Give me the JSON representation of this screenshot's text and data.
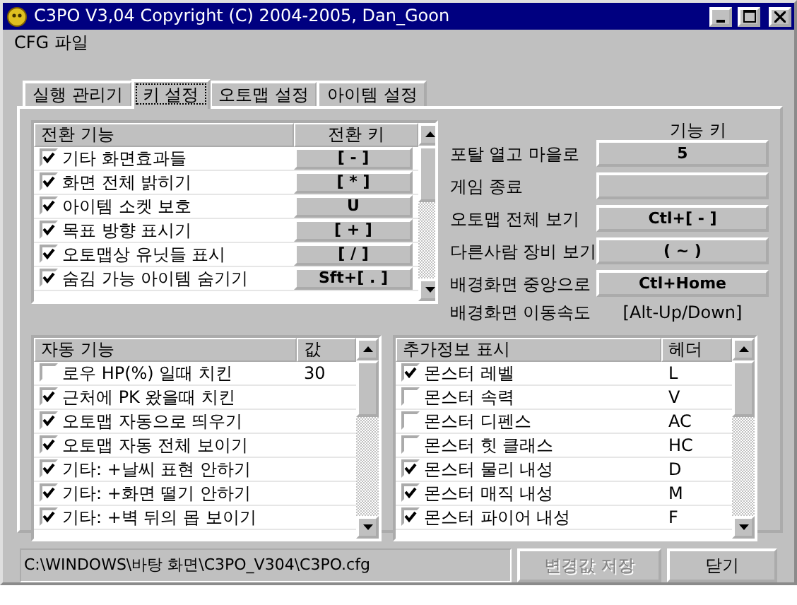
{
  "window": {
    "title": "C3PO V3,04 Copyright (C) 2004-2005, Dan_Goon"
  },
  "menu": [
    "CFG 파일"
  ],
  "tabs": [
    {
      "label": "실행 관리기",
      "selected": false
    },
    {
      "label": "키 설정",
      "selected": true
    },
    {
      "label": "오토맵 설정",
      "selected": false
    },
    {
      "label": "아이템 설정",
      "selected": false
    }
  ],
  "toggle_list": {
    "columns": [
      "전환 기능",
      "전환 키"
    ],
    "rows": [
      {
        "label": "기타 화면효과들",
        "checked": true,
        "key": "[ - ]"
      },
      {
        "label": "화면 전체 밝히기",
        "checked": true,
        "key": "[ * ]"
      },
      {
        "label": "아이템 소켓 보호",
        "checked": true,
        "key": "U"
      },
      {
        "label": "목표 방향 표시기",
        "checked": true,
        "key": "[ + ]"
      },
      {
        "label": "오토맵상 유닛들 표시",
        "checked": true,
        "key": "[ / ]"
      },
      {
        "label": "숨김 가능 아이템 숨기기",
        "checked": true,
        "key": "Sft+[ . ]"
      }
    ]
  },
  "function_keys": {
    "heading": "기능 키",
    "rows": [
      {
        "kind": "button",
        "label": "포탈 열고 마을로",
        "key": "5"
      },
      {
        "kind": "button",
        "label": "게임 종료"
      },
      {
        "kind": "button",
        "label": "오토맵 전체 보기",
        "key": "Ctl+[ - ]"
      },
      {
        "kind": "button",
        "label": "다른사람 장비 보기",
        "key": "( ~ )"
      },
      {
        "kind": "button",
        "label": "배경화면 중앙으로",
        "key": "Ctl+Home"
      },
      {
        "kind": "text",
        "label": "배경화면 이동속도",
        "key": "[Alt-Up/Down]"
      }
    ]
  },
  "auto_list": {
    "columns": [
      "자동 기능",
      "값"
    ],
    "rows": [
      {
        "label": "로우 HP(%) 일때 치킨",
        "checked": false,
        "value": "30"
      },
      {
        "label": "근처에 PK 왔을때 치킨",
        "checked": true
      },
      {
        "label": "오토맵 자동으로 띄우기",
        "checked": true
      },
      {
        "label": "오토맵 자동 전체 보이기",
        "checked": true
      },
      {
        "label": "기타: +날씨 표현 안하기",
        "checked": true
      },
      {
        "label": "기타: +화면 떨기 안하기",
        "checked": true
      },
      {
        "label": "기타: +벽 뒤의 몹 보이기",
        "checked": true
      }
    ]
  },
  "info_list": {
    "columns": [
      "추가정보 표시",
      "헤더"
    ],
    "rows": [
      {
        "label": "몬스터 레벨",
        "checked": true,
        "value": "L"
      },
      {
        "label": "몬스터 속력",
        "checked": false,
        "value": "V"
      },
      {
        "label": "몬스터 디펜스",
        "checked": false,
        "value": "AC"
      },
      {
        "label": "몬스터 힛 클래스",
        "checked": false,
        "value": "HC"
      },
      {
        "label": "몬스터 물리 내성",
        "checked": true,
        "value": "D"
      },
      {
        "label": "몬스터 매직 내성",
        "checked": true,
        "value": "M"
      },
      {
        "label": "몬스터 파이어 내성",
        "checked": true,
        "value": "F"
      }
    ]
  },
  "path": "C:\\WINDOWS\\바탕 화면\\C3PO_V304\\C3PO.cfg",
  "buttons": [
    {
      "label": "변경값 저장",
      "disabled": true
    },
    {
      "label": "닫기",
      "disabled": false
    }
  ]
}
